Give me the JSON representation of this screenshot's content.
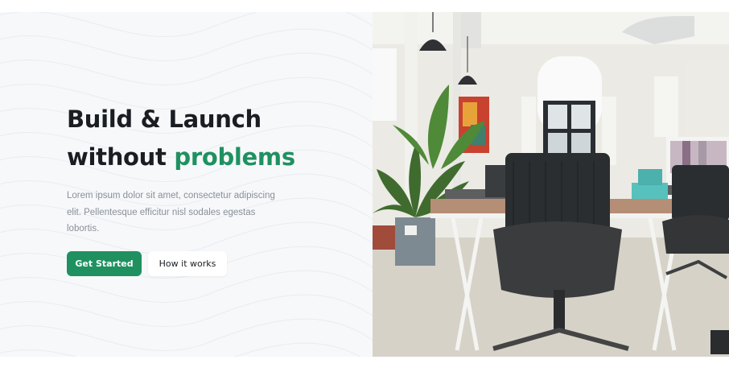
{
  "hero": {
    "headline_line1": "Build & Launch",
    "headline_line2_prefix": "without ",
    "headline_accent": "problems",
    "description": "Lorem ipsum dolor sit amet, consectetur adipiscing elit. Pellentesque efficitur nisl sodales egestas lobortis.",
    "primary_button": "Get Started",
    "secondary_button": "How it works"
  },
  "colors": {
    "accent": "#1f9160",
    "heading": "#1a1d21",
    "body_text": "#8a9099",
    "left_panel_bg": "#f6f8fa"
  },
  "image": {
    "subject": "office-interior-photo"
  }
}
